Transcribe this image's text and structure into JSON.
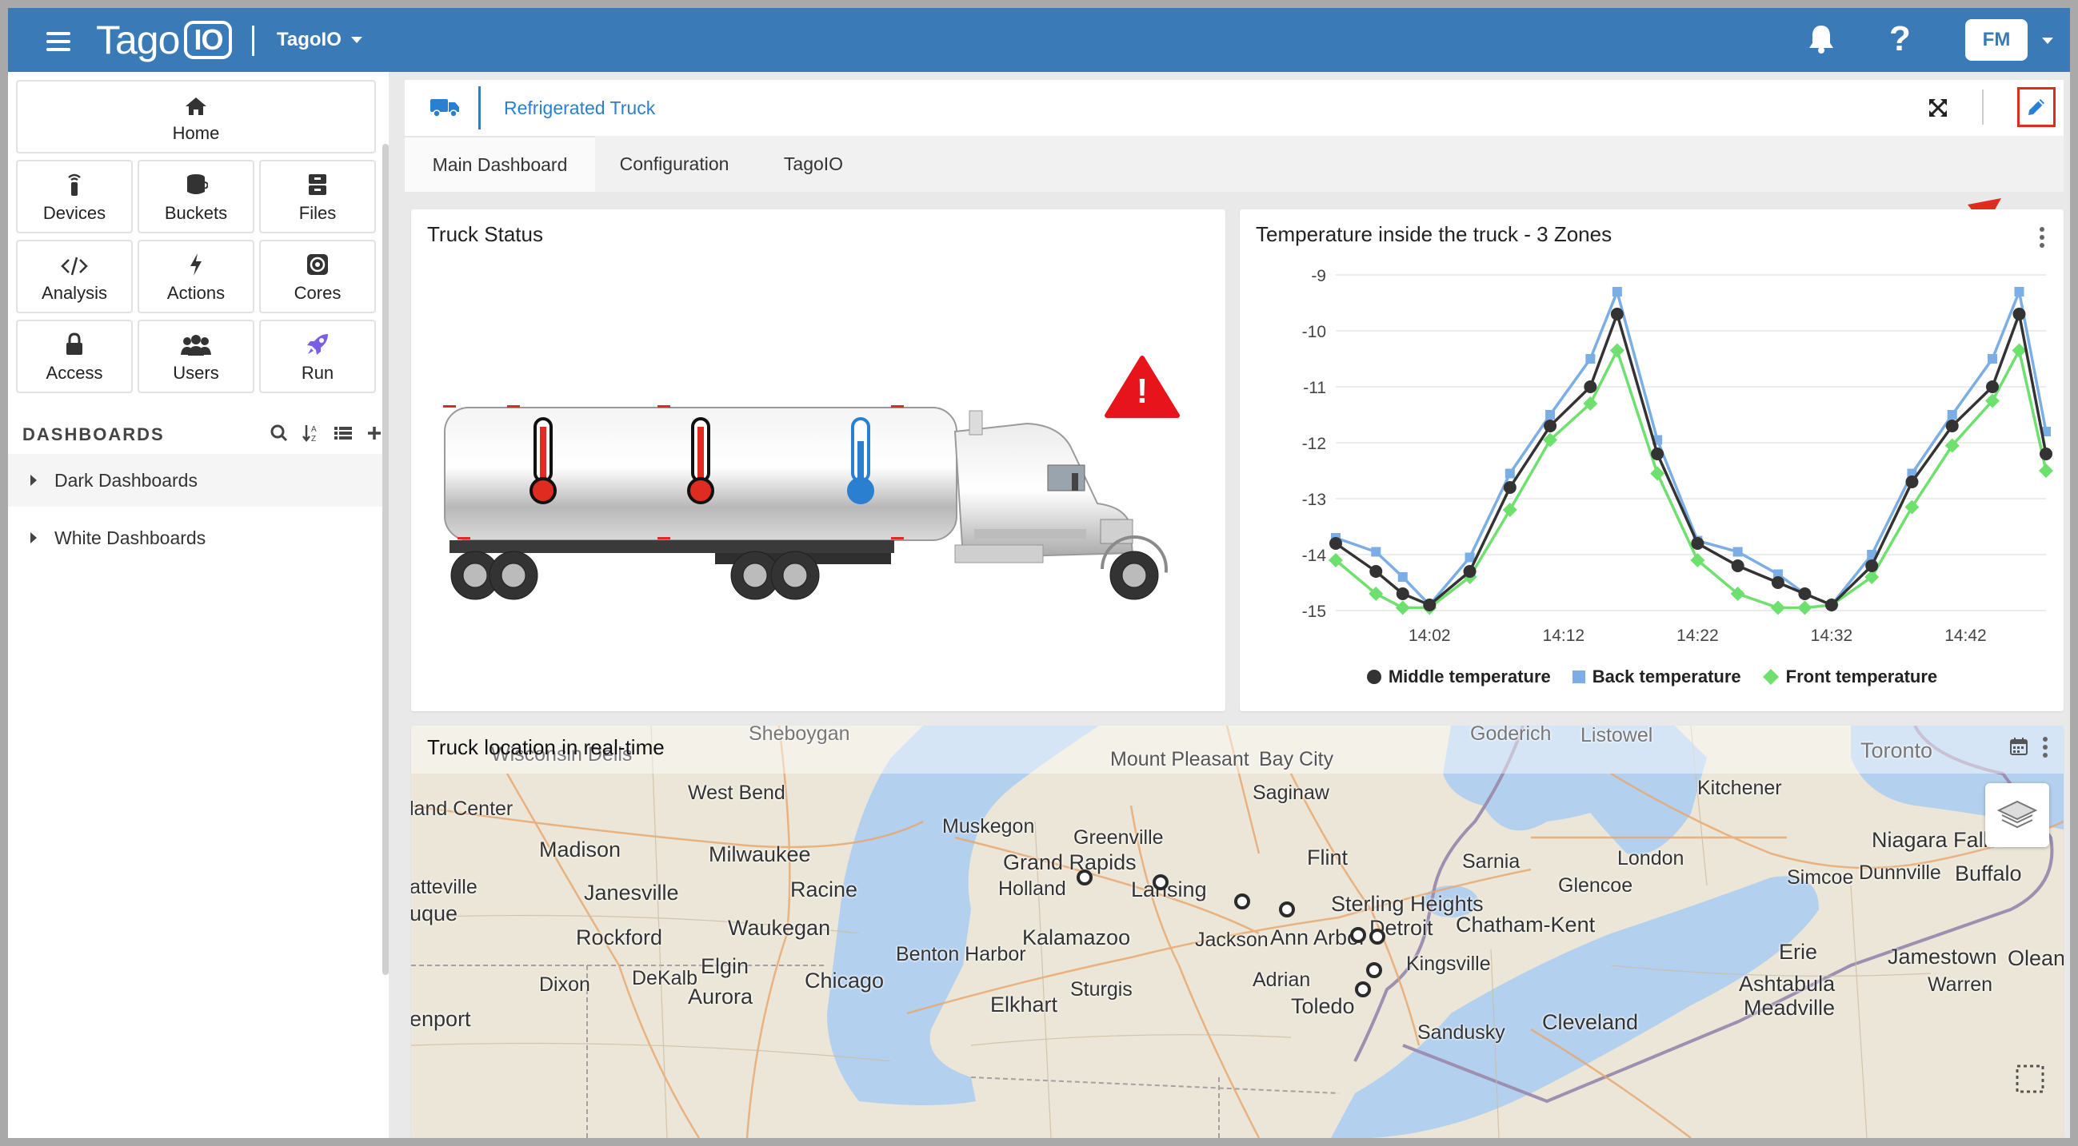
{
  "topbar": {
    "logo_text": "Tago",
    "logo_io": "IO",
    "account": "TagoIO",
    "help": "?",
    "avatar": "FM",
    "icons": [
      "menu-icon",
      "bell-icon",
      "help-icon",
      "chevron-down-icon"
    ]
  },
  "sidebar": {
    "nav": [
      {
        "label": "Home",
        "icon": "home-icon"
      },
      {
        "label": "Devices",
        "icon": "device-icon"
      },
      {
        "label": "Buckets",
        "icon": "bucket-icon"
      },
      {
        "label": "Files",
        "icon": "files-icon"
      },
      {
        "label": "Analysis",
        "icon": "code-icon"
      },
      {
        "label": "Actions",
        "icon": "bolt-icon"
      },
      {
        "label": "Cores",
        "icon": "cores-icon"
      },
      {
        "label": "Access",
        "icon": "lock-icon"
      },
      {
        "label": "Users",
        "icon": "users-icon"
      },
      {
        "label": "Run",
        "icon": "rocket-icon"
      }
    ],
    "dashboards_title": "DASHBOARDS",
    "folders": [
      "Dark Dashboards",
      "White Dashboards"
    ]
  },
  "dashboard": {
    "name": "Refrigerated Truck",
    "tabs": [
      "Main Dashboard",
      "Configuration",
      "TagoIO"
    ],
    "active_tab": "Main Dashboard",
    "accent": "#3a7ab7",
    "highlight": "#e02b20"
  },
  "widgets": {
    "truck_status": {
      "title": "Truck Status",
      "zones": [
        "hot",
        "hot",
        "cold"
      ],
      "alert": "!"
    },
    "temperature": {
      "title": "Temperature inside the truck - 3 Zones"
    },
    "map": {
      "title": "Truck location in real-time",
      "places": [
        "Sheboygan",
        "Wisconsin Dells",
        "Goderich",
        "Listowel",
        "Toronto",
        "Mount Pleasant",
        "Bay City",
        "land Center",
        "West Bend",
        "Saginaw",
        "Kitchener",
        "Muskegon",
        "Greenville",
        "Madison",
        "Milwaukee",
        "Flint",
        "Sarnia",
        "London",
        "Niagara Falls",
        "Grand Rapids",
        "Dunnville",
        "Buffalo",
        "Holland",
        "Lansing",
        "atteville",
        "Janesville",
        "Racine",
        "Simcoe",
        "Glencoe",
        "Sterling Heights",
        "uque",
        "Chatham-Kent",
        "Detroit",
        "Waukegan",
        "Kalamazoo",
        "Jackson",
        "Ann Arbor",
        "Rockford",
        "Benton Harbor",
        "Erie",
        "Jamestown",
        "Olean",
        "Elgin",
        "Kingsville",
        "DeKalb",
        "Chicago",
        "Adrian",
        "Dixon",
        "Ashtabula",
        "Warren",
        "Aurora",
        "Sturgis",
        "Elkhart",
        "Toledo",
        "Meadville",
        "enport",
        "Cleveland",
        "Sandusky"
      ]
    }
  },
  "chart_data": {
    "type": "line",
    "title": "Temperature inside the truck - 3 Zones",
    "xlabel": "",
    "ylabel": "",
    "x_tick_labels": [
      "14:02",
      "14:12",
      "14:22",
      "14:32",
      "14:42"
    ],
    "y_ticks": [
      -9,
      -10,
      -11,
      -12,
      -13,
      -14,
      -15
    ],
    "ylim": [
      -15,
      -9
    ],
    "x_minutes": [
      -5,
      -2,
      0,
      2,
      5,
      8,
      11,
      14,
      16,
      19,
      22,
      25,
      28,
      30,
      32,
      35,
      38,
      41,
      44,
      46,
      48
    ],
    "series": [
      {
        "name": "Middle temperature",
        "color": "#333333",
        "marker": "circle",
        "values": [
          -13.8,
          -14.3,
          -14.7,
          -14.9,
          -14.3,
          -12.8,
          -11.7,
          -11.0,
          -9.7,
          -12.2,
          -13.8,
          -14.2,
          -14.5,
          -14.7,
          -14.9,
          -14.2,
          -12.7,
          -11.7,
          -11.0,
          -9.7,
          -12.2
        ]
      },
      {
        "name": "Back temperature",
        "color": "#7aaee5",
        "marker": "square",
        "values": [
          -13.7,
          -13.95,
          -14.4,
          -14.9,
          -14.05,
          -12.55,
          -11.5,
          -10.5,
          -9.3,
          -11.95,
          -13.75,
          -13.95,
          -14.35,
          -14.7,
          -14.9,
          -14.0,
          -12.55,
          -11.5,
          -10.5,
          -9.3,
          -11.8
        ]
      },
      {
        "name": "Front temperature",
        "color": "#6ee06e",
        "marker": "diamond",
        "values": [
          -14.1,
          -14.7,
          -14.95,
          -14.95,
          -14.4,
          -13.2,
          -11.95,
          -11.3,
          -10.35,
          -12.55,
          -14.1,
          -14.7,
          -14.95,
          -14.95,
          -14.9,
          -14.4,
          -13.15,
          -12.05,
          -11.25,
          -10.35,
          -12.5
        ]
      }
    ],
    "grid": true,
    "legend": "bottom"
  }
}
